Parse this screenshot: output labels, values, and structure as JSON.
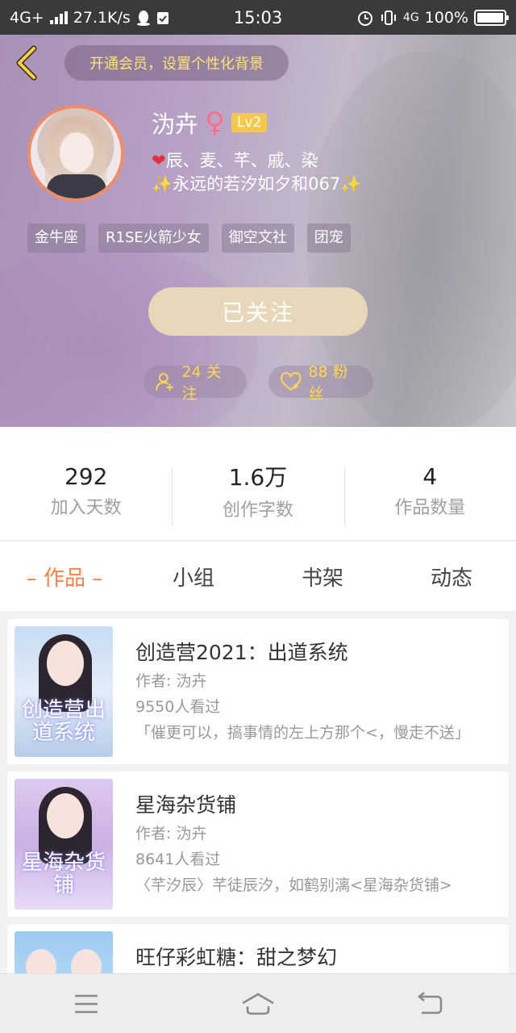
{
  "status_bar": {
    "network": "4G+",
    "speed": "27.1K/s",
    "time": "15:03",
    "network_right": "4G",
    "battery": "100%"
  },
  "header": {
    "vip_banner": "开通会员，设置个性化背景",
    "name": "沩卉",
    "gender_symbol": "♀",
    "level": "Lv2",
    "bio_line1": "辰、麦、芊、戚、染",
    "bio_heart": "❤",
    "bio_line2": "永远的若汐如夕和067",
    "bio_spark": "✨",
    "tags": [
      "金牛座",
      "R1SE火箭少女",
      "御空文社",
      "团宠"
    ],
    "follow_button": "已关注",
    "following_label": "24 关注",
    "fans_label": "88 粉丝"
  },
  "stats": [
    {
      "value": "292",
      "label": "加入天数"
    },
    {
      "value": "1.6万",
      "label": "创作字数"
    },
    {
      "value": "4",
      "label": "作品数量"
    }
  ],
  "tabs": [
    "– 作品 –",
    "小组",
    "书架",
    "动态"
  ],
  "works": [
    {
      "title": "创造营2021：出道系统",
      "author": "作者: 沩卉",
      "views": "9550人看过",
      "desc": "「催更可以，搞事情的左上方那个<，慢走不送」",
      "cover_text": "创造营出道系统"
    },
    {
      "title": "星海杂货铺",
      "author": "作者: 沩卉",
      "views": "8641人看过",
      "desc": "〈芊汐辰〉芊徒辰汐，如鹤别漓<星海杂货铺>",
      "cover_text": "星海杂货铺"
    },
    {
      "title": "旺仔彩虹糖：甜之梦幻",
      "author": "",
      "views": "",
      "desc": "",
      "cover_text": ""
    }
  ],
  "colors": {
    "accent": "#f0824c",
    "vip_text": "#ffe27a",
    "follow_button_bg": "#e6d8b8",
    "gender": "#ff6d8d",
    "level_badge": "#f3c84b"
  },
  "icons": {
    "back": "chevron-left-icon",
    "following": "user-add-icon",
    "fans": "heart-icon",
    "nav": [
      "menu-icon",
      "home-icon",
      "back-icon"
    ]
  }
}
